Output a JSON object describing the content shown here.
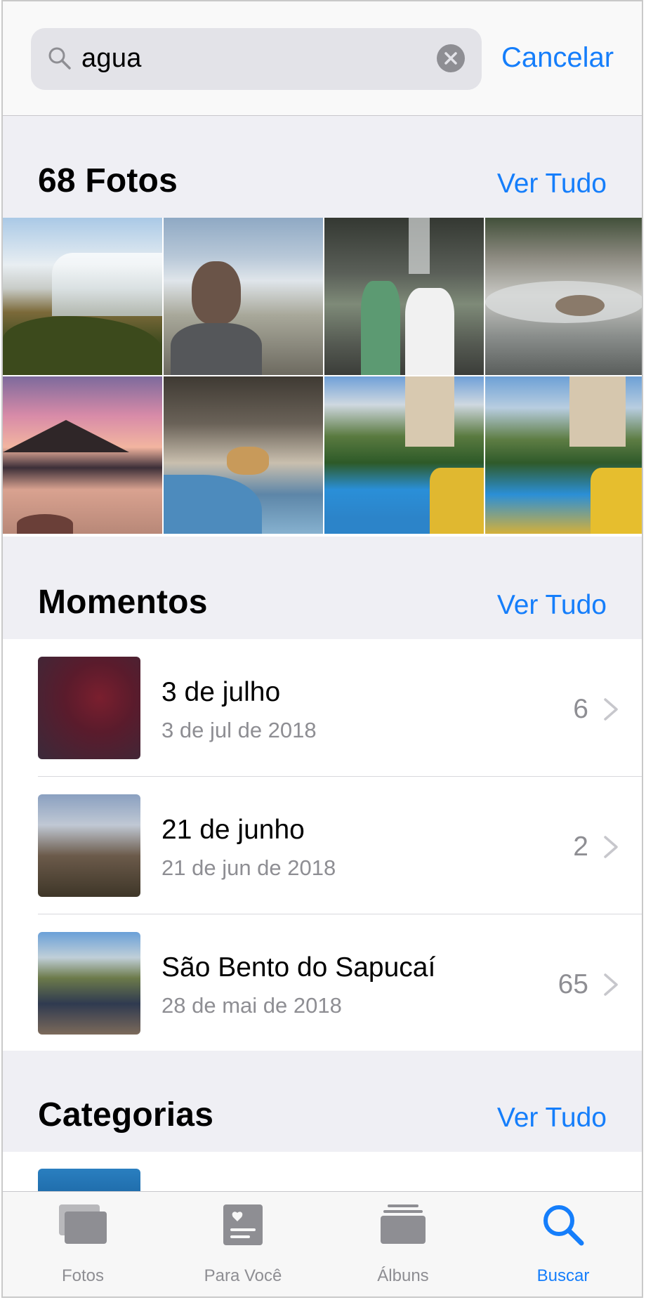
{
  "search": {
    "query": "agua",
    "cancel_label": "Cancelar"
  },
  "photos": {
    "title": "68 Fotos",
    "see_all": "Ver Tudo"
  },
  "moments": {
    "title": "Momentos",
    "see_all": "Ver Tudo",
    "items": [
      {
        "title": "3 de julho",
        "date": "3 de jul de 2018",
        "count": "6"
      },
      {
        "title": "21 de junho",
        "date": "21 de jun de 2018",
        "count": "2"
      },
      {
        "title": "São Bento do Sapucaí",
        "date": "28 de mai de 2018",
        "count": "65"
      }
    ]
  },
  "categories": {
    "title": "Categorias",
    "see_all": "Ver Tudo"
  },
  "tabbar": {
    "items": [
      {
        "label": "Fotos",
        "icon": "photos-icon"
      },
      {
        "label": "Para Você",
        "icon": "for-you-icon"
      },
      {
        "label": "Álbuns",
        "icon": "albums-icon"
      },
      {
        "label": "Buscar",
        "icon": "search-icon",
        "active": true
      }
    ]
  },
  "colors": {
    "accent": "#157efb",
    "secondary_text": "#8e8e93",
    "grouped_background": "#efeff4"
  }
}
